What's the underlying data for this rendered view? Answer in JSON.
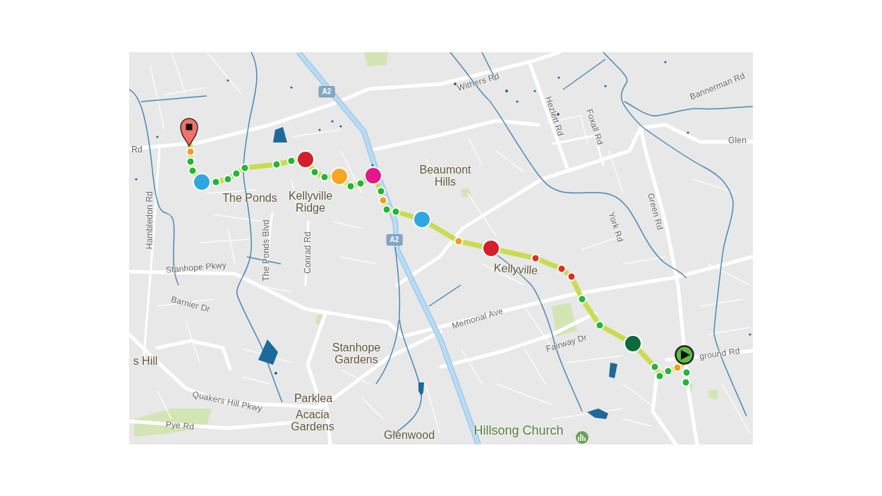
{
  "map": {
    "labels": [
      {
        "text": "Withers Rd",
        "kind": "street"
      },
      {
        "text": "Bannerman Rd",
        "kind": "street"
      },
      {
        "text": "Hezlett Rd",
        "kind": "street"
      },
      {
        "text": "Foxall Rd",
        "kind": "street"
      },
      {
        "text": "Rd",
        "kind": "street"
      },
      {
        "text": "Glen",
        "kind": "street"
      },
      {
        "text": "Beaumont Hills",
        "kind": "place"
      },
      {
        "text": "The Ponds",
        "kind": "place"
      },
      {
        "text": "Kellyville Ridge",
        "kind": "place"
      },
      {
        "text": "Green Rd",
        "kind": "street"
      },
      {
        "text": "Hambledon Rd",
        "kind": "street"
      },
      {
        "text": "York Rd",
        "kind": "street"
      },
      {
        "text": "The Ponds Blvd",
        "kind": "street"
      },
      {
        "text": "Conrad Rd",
        "kind": "street"
      },
      {
        "text": "Kellyville",
        "kind": "place"
      },
      {
        "text": "Stanhope Pkwy",
        "kind": "street"
      },
      {
        "text": "Barnier Dr",
        "kind": "street"
      },
      {
        "text": "Memorial Ave",
        "kind": "street"
      },
      {
        "text": "Fairway Dr",
        "kind": "street"
      },
      {
        "text": "ground Rd",
        "kind": "street"
      },
      {
        "text": "s Hill",
        "kind": "place"
      },
      {
        "text": "Stanhope Gardens",
        "kind": "place"
      },
      {
        "text": "Quakers Hill Pkwy",
        "kind": "street"
      },
      {
        "text": "Parklea",
        "kind": "place"
      },
      {
        "text": "Acacia Gardens",
        "kind": "place"
      },
      {
        "text": "Pye Rd",
        "kind": "street"
      },
      {
        "text": "Glenwood",
        "kind": "place"
      },
      {
        "text": "Hillsong Church",
        "kind": "landmark"
      }
    ],
    "shields": [
      {
        "text": "A2"
      },
      {
        "text": "A2"
      }
    ],
    "markers": [
      {
        "kind": "small",
        "color": "#f39c1f"
      },
      {
        "kind": "small",
        "color": "#1fb835"
      },
      {
        "kind": "small",
        "color": "#1fb835"
      },
      {
        "kind": "large",
        "color": "#2ea8e0"
      },
      {
        "kind": "small",
        "color": "#1fb835"
      },
      {
        "kind": "small",
        "color": "#1fb835"
      },
      {
        "kind": "small",
        "color": "#1fb835"
      },
      {
        "kind": "small",
        "color": "#1fb835"
      },
      {
        "kind": "small",
        "color": "#1fb835"
      },
      {
        "kind": "small",
        "color": "#1fb835"
      },
      {
        "kind": "large",
        "color": "#d3202c"
      },
      {
        "kind": "small",
        "color": "#1fb835"
      },
      {
        "kind": "small",
        "color": "#1fb835"
      },
      {
        "kind": "large",
        "color": "#f6a623"
      },
      {
        "kind": "small",
        "color": "#1fb835"
      },
      {
        "kind": "small",
        "color": "#1fb835"
      },
      {
        "kind": "large",
        "color": "#e5178c"
      },
      {
        "kind": "small",
        "color": "#1fb835"
      },
      {
        "kind": "small",
        "color": "#f39c1f"
      },
      {
        "kind": "small",
        "color": "#1fb835"
      },
      {
        "kind": "small",
        "color": "#1fb835"
      },
      {
        "kind": "large",
        "color": "#2ea8e0"
      },
      {
        "kind": "small",
        "color": "#f39c1f"
      },
      {
        "kind": "large",
        "color": "#d3202c"
      },
      {
        "kind": "small",
        "color": "#e52b26"
      },
      {
        "kind": "small",
        "color": "#e52b26"
      },
      {
        "kind": "small",
        "color": "#e52b26"
      },
      {
        "kind": "small",
        "color": "#1fb835"
      },
      {
        "kind": "small",
        "color": "#1fb835"
      },
      {
        "kind": "large",
        "color": "#0c6b3a"
      },
      {
        "kind": "small",
        "color": "#1fb835"
      },
      {
        "kind": "small",
        "color": "#1fb835"
      },
      {
        "kind": "small",
        "color": "#1fb835"
      },
      {
        "kind": "small",
        "color": "#f39c1f"
      },
      {
        "kind": "small",
        "color": "#1fb835"
      },
      {
        "kind": "small",
        "color": "#1fb835"
      }
    ]
  }
}
